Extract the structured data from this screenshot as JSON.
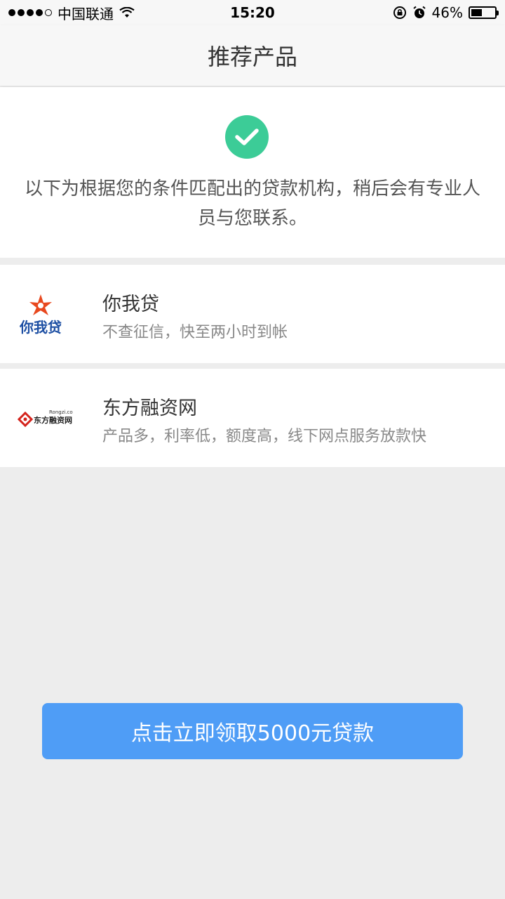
{
  "status": {
    "carrier": "中国联通",
    "time": "15:20",
    "battery": "46%",
    "battery_level": 0.46
  },
  "nav": {
    "title": "推荐产品"
  },
  "result": {
    "message": "以下为根据您的条件匹配出的贷款机构，稍后会有专业人员与您联系。",
    "accent_color": "#3ccc97"
  },
  "products": [
    {
      "name": "你我贷",
      "desc": "不查征信，快至两小时到帐",
      "logo_text": "你我贷"
    },
    {
      "name": "东方融资网",
      "desc": "产品多，利率低，额度高，线下网点服务放款快",
      "logo_text": "东方融资网",
      "logo_sub": "Rongzi.com"
    }
  ],
  "cta": {
    "label": "点击立即领取5000元贷款",
    "color": "#4f9df6"
  }
}
